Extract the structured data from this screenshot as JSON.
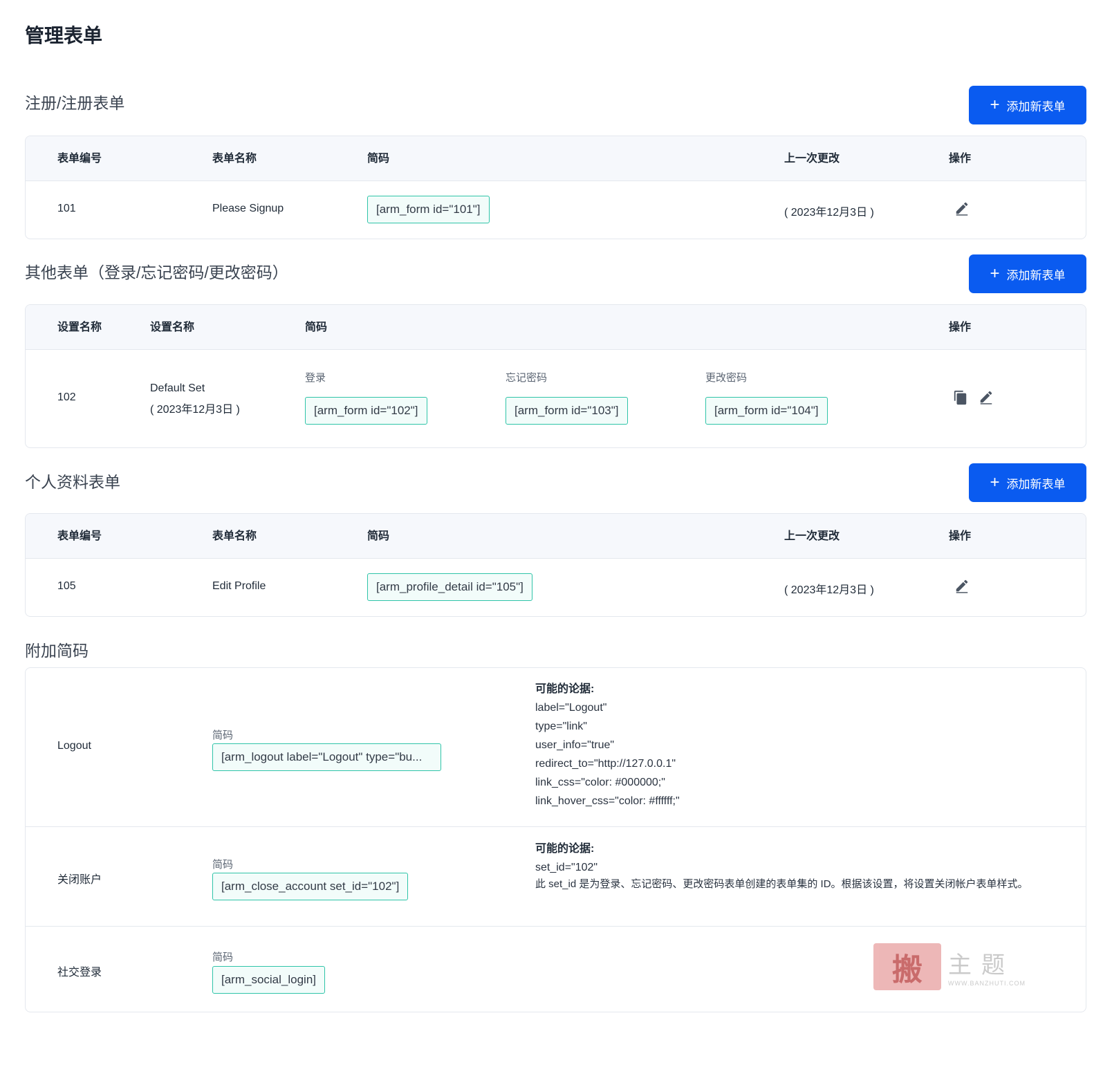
{
  "page": {
    "title": "管理表单"
  },
  "sections": {
    "signup": {
      "title": "注册/注册表单",
      "add_button": "添加新表单",
      "headers": [
        "表单编号",
        "表单名称",
        "简码",
        "上一次更改",
        "操作"
      ],
      "row": {
        "id": "101",
        "name": "Please Signup",
        "shortcode": "[arm_form id=\"101\"]",
        "modified": "( 2023年12月3日 )"
      }
    },
    "other": {
      "title": "其他表单（登录/忘记密码/更改密码）",
      "add_button": "添加新表单",
      "headers": [
        "设置名称",
        "设置名称",
        "简码",
        "操作"
      ],
      "row": {
        "id": "102",
        "name": "Default Set",
        "date": "( 2023年12月3日 )",
        "login_label": "登录",
        "login_code": "[arm_form id=\"102\"]",
        "forgot_label": "忘记密码",
        "forgot_code": "[arm_form id=\"103\"]",
        "change_label": "更改密码",
        "change_code": "[arm_form id=\"104\"]"
      }
    },
    "profile": {
      "title": "个人资料表单",
      "add_button": "添加新表单",
      "headers": [
        "表单编号",
        "表单名称",
        "简码",
        "上一次更改",
        "操作"
      ],
      "row": {
        "id": "105",
        "name": "Edit Profile",
        "shortcode": "[arm_profile_detail id=\"105\"]",
        "modified": "( 2023年12月3日 )"
      }
    },
    "additional": {
      "title": "附加简码",
      "rows": [
        {
          "name": "Logout",
          "label": "简码",
          "code": "[arm_logout label=\"Logout\" type=\"bu...",
          "args_title": "可能的论据:",
          "args": [
            "label=\"Logout\"",
            "type=\"link\"",
            "user_info=\"true\"",
            "redirect_to=\"http://127.0.0.1\"",
            "link_css=\"color: #000000;\"",
            "link_hover_css=\"color: #ffffff;\""
          ]
        },
        {
          "name": "关闭账户",
          "label": "简码",
          "code": "[arm_close_account set_id=\"102\"]",
          "args_title": "可能的论据:",
          "args": [
            "set_id=\"102\""
          ],
          "note": "此 set_id 是为登录、忘记密码、更改密码表单创建的表单集的 ID。根据该设置，将设置关闭帐户表单样式。"
        },
        {
          "name": "社交登录",
          "label": "简码",
          "code": "[arm_social_login]"
        }
      ]
    }
  },
  "watermark": {
    "stamp": "搬",
    "text": "主题",
    "url": "WWW.BANZHUTI.COM"
  },
  "colors": {
    "accent": "#0a5bf0",
    "shortcode_border": "#2ec4a8"
  },
  "icons": {
    "edit": "pencil-icon",
    "copy": "copy-icon",
    "add": "plus-icon"
  }
}
